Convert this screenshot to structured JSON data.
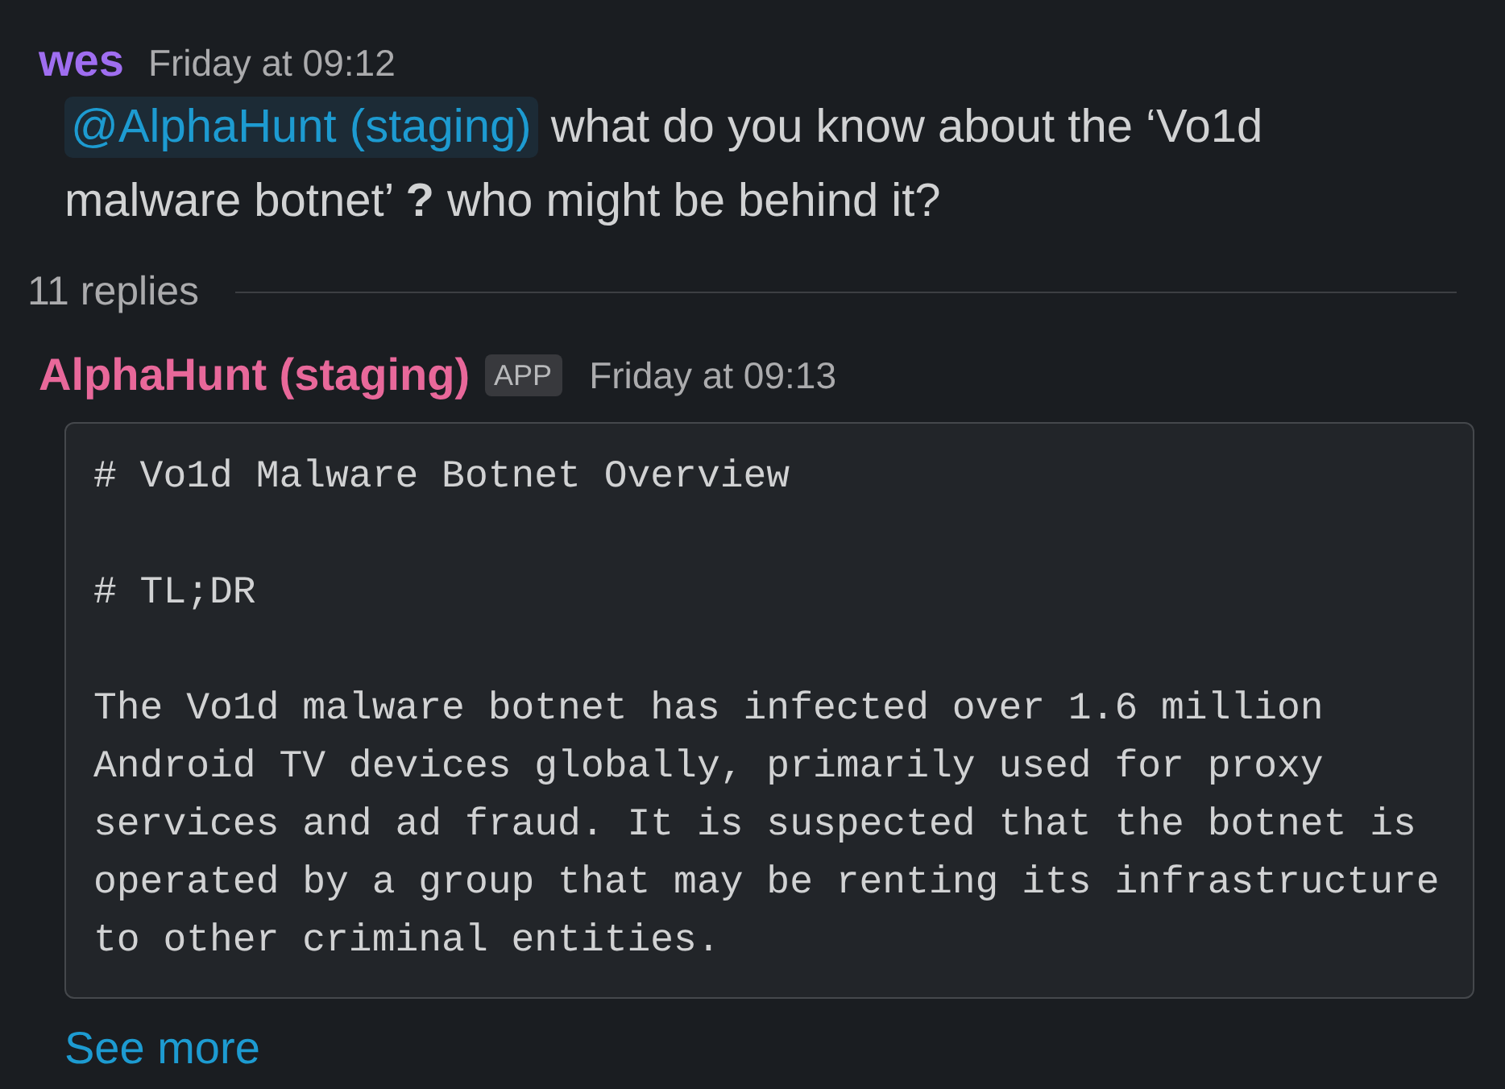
{
  "parent_message": {
    "author": "wes",
    "color": "#9f6ef0",
    "time": "Friday at 09:12",
    "mention": "@AlphaHunt (staging)",
    "text": "what do you know about the ‘Vo1d malware botnet’ **?** who might be behind it?"
  },
  "thread_replies": {
    "label": "11 replies"
  },
  "reply_message": {
    "author": "AlphaHunt (staging)",
    "color": "#e8689a",
    "badge": "APP",
    "time": "Friday at 09:13",
    "code_block": [
      "# Vo1d Malware Botnet Overview",
      "# TL;DR",
      "The Vo1d malware botnet has infected over 1.6 million Android TV devices globally, primarily used for proxy services and ad fraud. It is suspected that the botnet is operated by a group that may be renting its infrastructure to other criminal entities."
    ],
    "see_more": "See more"
  }
}
